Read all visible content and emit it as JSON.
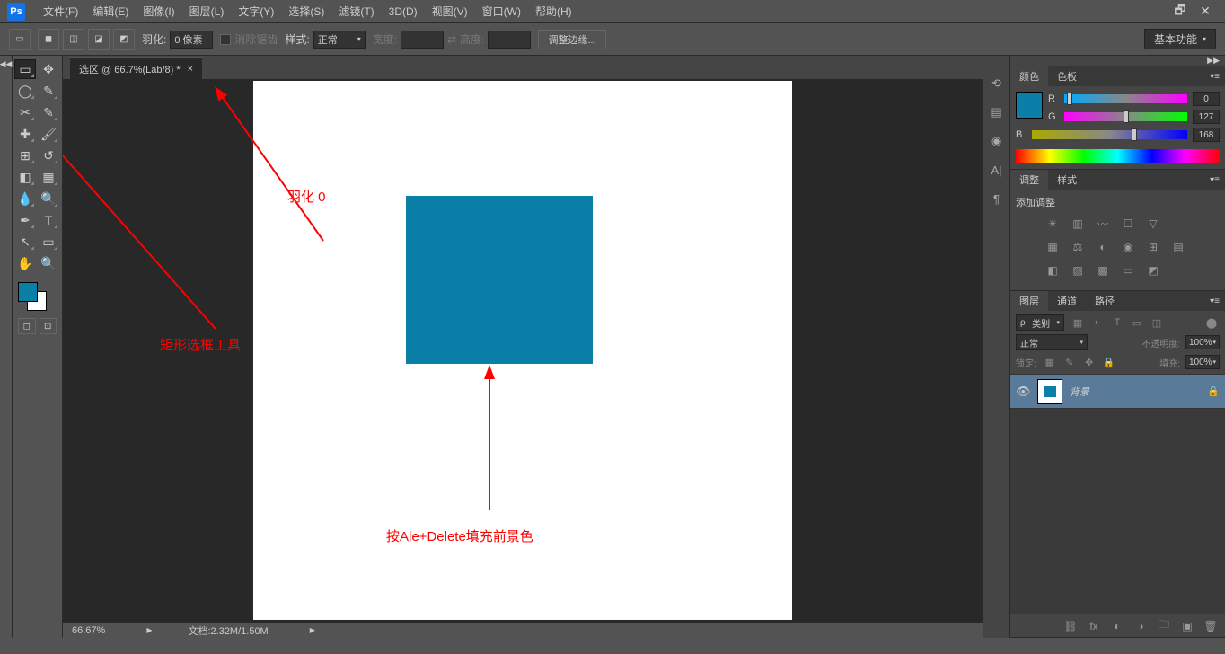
{
  "app": {
    "logo": "Ps"
  },
  "menu": {
    "file": "文件(F)",
    "edit": "编辑(E)",
    "image": "图像(I)",
    "layer": "图层(L)",
    "type": "文字(Y)",
    "select": "选择(S)",
    "filter": "滤镜(T)",
    "threeD": "3D(D)",
    "view": "视图(V)",
    "window": "窗口(W)",
    "help": "帮助(H)"
  },
  "options": {
    "feather_label": "羽化:",
    "feather_value": "0 像素",
    "antialias": "消除锯齿",
    "style_label": "样式:",
    "style_value": "正常",
    "width_label": "宽度:",
    "height_label": "高度:",
    "refine": "调整边缘...",
    "workspace": "基本功能"
  },
  "document": {
    "tab": "选区 @ 66.7%(Lab/8) *"
  },
  "annotations": {
    "feather0": "羽化 0",
    "marquee_tool": "矩形选框工具",
    "fill": "按Ale+Delete填充前景色"
  },
  "status": {
    "zoom": "66.67%",
    "doc_info": "文档:2.32M/1.50M"
  },
  "panels": {
    "color": {
      "tab1": "颜色",
      "tab2": "色板",
      "r": {
        "lbl": "R",
        "val": "0"
      },
      "g": {
        "lbl": "G",
        "val": "127"
      },
      "b": {
        "lbl": "B",
        "val": "168"
      }
    },
    "adjust": {
      "tab1": "调整",
      "tab2": "样式",
      "title": "添加调整"
    },
    "layers": {
      "tab1": "图层",
      "tab2": "通道",
      "tab3": "路径",
      "type_filter": "类别",
      "blend": "正常",
      "opacity_label": "不透明度:",
      "opacity": "100%",
      "lock_label": "锁定:",
      "fill_label": "填充:",
      "fill": "100%",
      "layer_name": "背景"
    }
  }
}
